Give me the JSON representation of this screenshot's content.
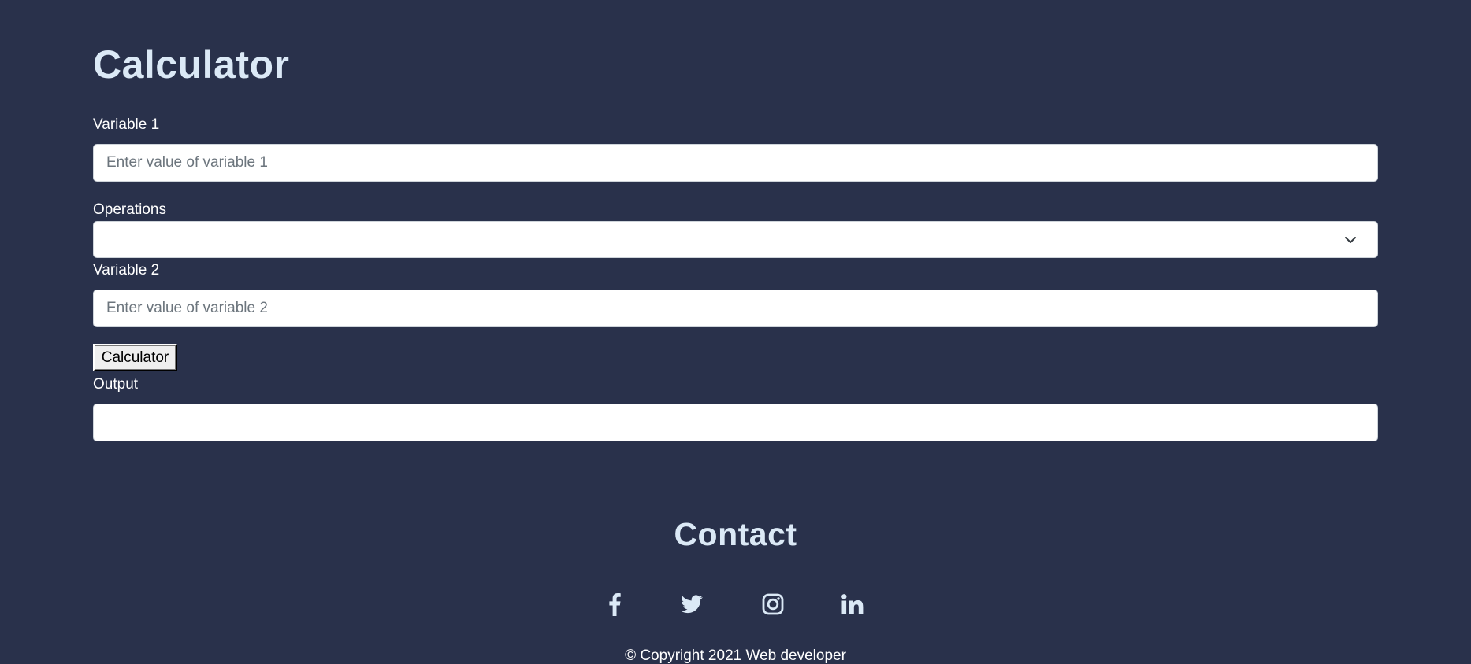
{
  "calculator": {
    "title": "Calculator",
    "variable1": {
      "label": "Variable 1",
      "value": "",
      "placeholder": "Enter value of variable 1"
    },
    "operations": {
      "label": "Operations",
      "selected": ""
    },
    "variable2": {
      "label": "Variable 2",
      "value": "",
      "placeholder": "Enter value of variable 2"
    },
    "button_label": "Calculator",
    "output": {
      "label": "Output",
      "value": ""
    }
  },
  "contact": {
    "title": "Contact",
    "social": [
      {
        "icon": "facebook-icon"
      },
      {
        "icon": "twitter-icon"
      },
      {
        "icon": "instagram-icon"
      },
      {
        "icon": "linkedin-icon"
      }
    ],
    "copyright": "© Copyright 2021 Web developer"
  },
  "colors": {
    "background": "#29314b",
    "heading": "#dbe9f6",
    "text": "#ffffff"
  }
}
